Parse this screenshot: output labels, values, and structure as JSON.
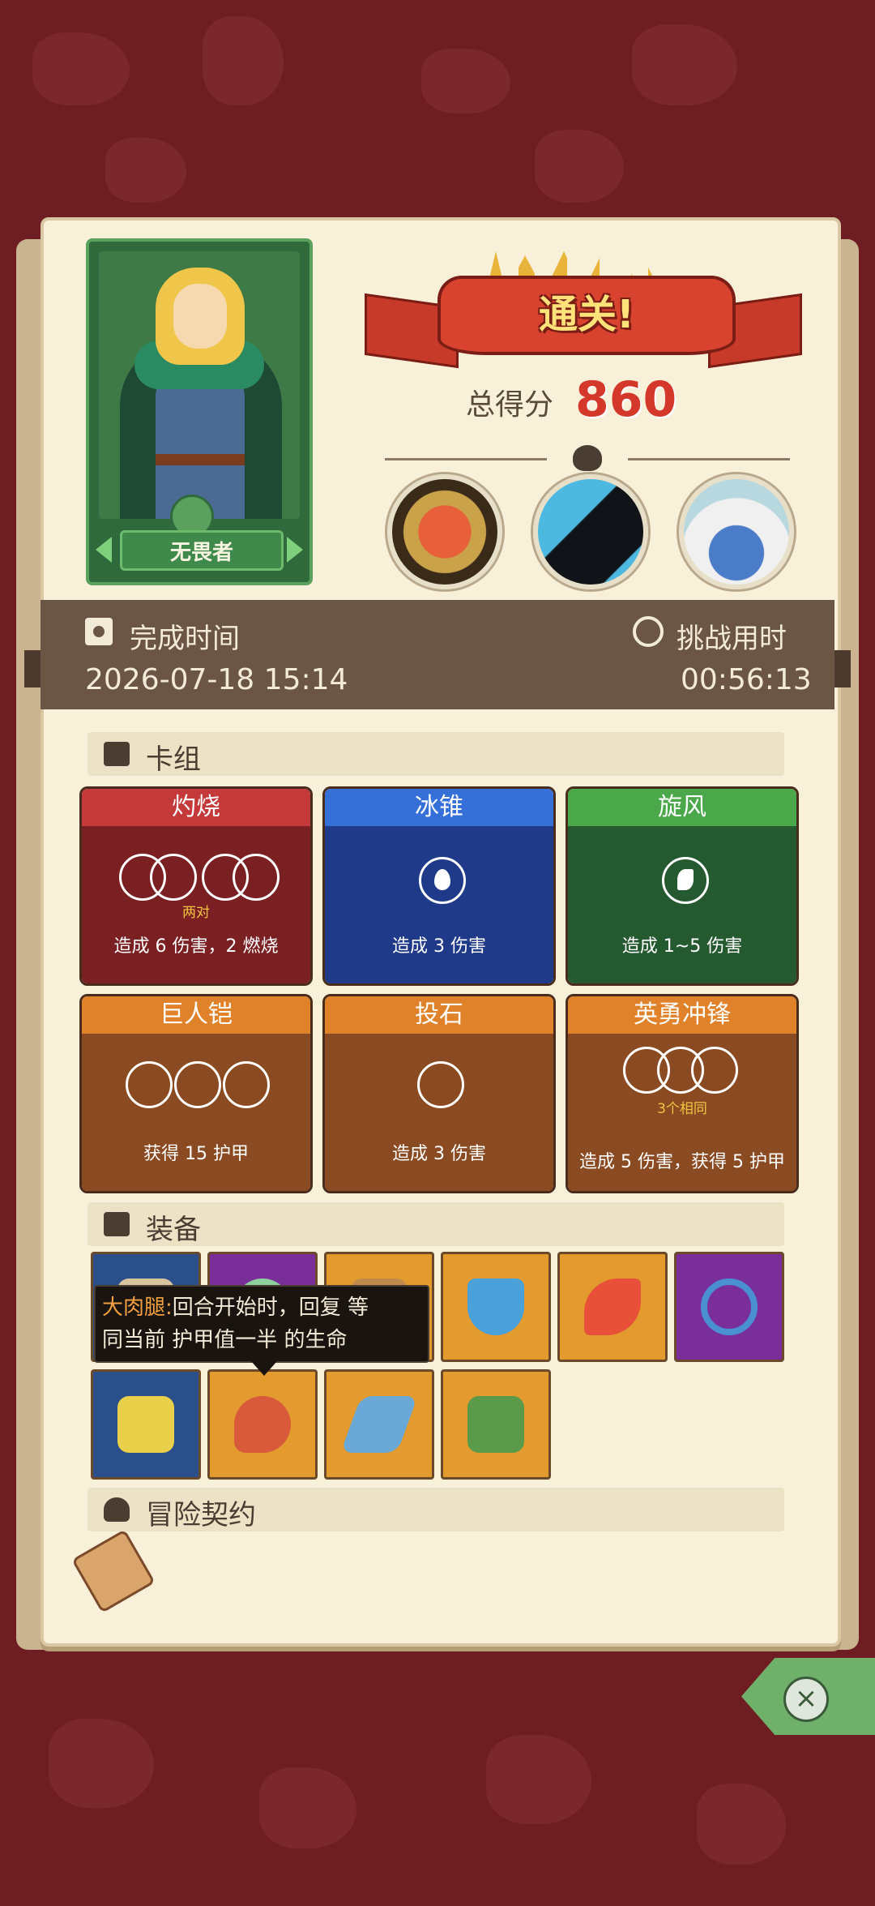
{
  "hero": {
    "name": "无畏者"
  },
  "banner": {
    "title": "通关!"
  },
  "score": {
    "label": "总得分",
    "value": "860"
  },
  "bosses": [
    "boss-1",
    "boss-2",
    "boss-3"
  ],
  "time": {
    "complete_label": "完成时间",
    "complete_value": "2026-07-18 15:14",
    "challenge_label": "挑战用时",
    "challenge_value": "00:56:13"
  },
  "sections": {
    "deck": "卡组",
    "equipment": "装备",
    "contract": "冒险契约"
  },
  "cards": [
    {
      "name": "灼烧",
      "color": "red",
      "cond": "两对",
      "desc": "造成 6 伤害，2 燃烧"
    },
    {
      "name": "冰锥",
      "color": "blue",
      "cond": "",
      "desc": "造成 3 伤害"
    },
    {
      "name": "旋风",
      "color": "green",
      "cond": "",
      "desc": "造成 1~5 伤害"
    },
    {
      "name": "巨人铠",
      "color": "orange",
      "cond": "",
      "desc": "获得 15 护甲"
    },
    {
      "name": "投石",
      "color": "orange",
      "cond": "",
      "desc": "造成 3 伤害"
    },
    {
      "name": "英勇冲锋",
      "color": "orange",
      "cond": "3个相同",
      "desc": "造成 5 伤害，获得 5 护甲"
    }
  ],
  "tooltip": {
    "name": "大肉腿:",
    "line1": "回合开始时，回复 等",
    "line2": "同当前 护甲值一半 的生命"
  },
  "colors": {
    "red": "#c43a3a",
    "blue": "#3470d8",
    "green": "#4aa84a",
    "orange": "#e0822a"
  }
}
